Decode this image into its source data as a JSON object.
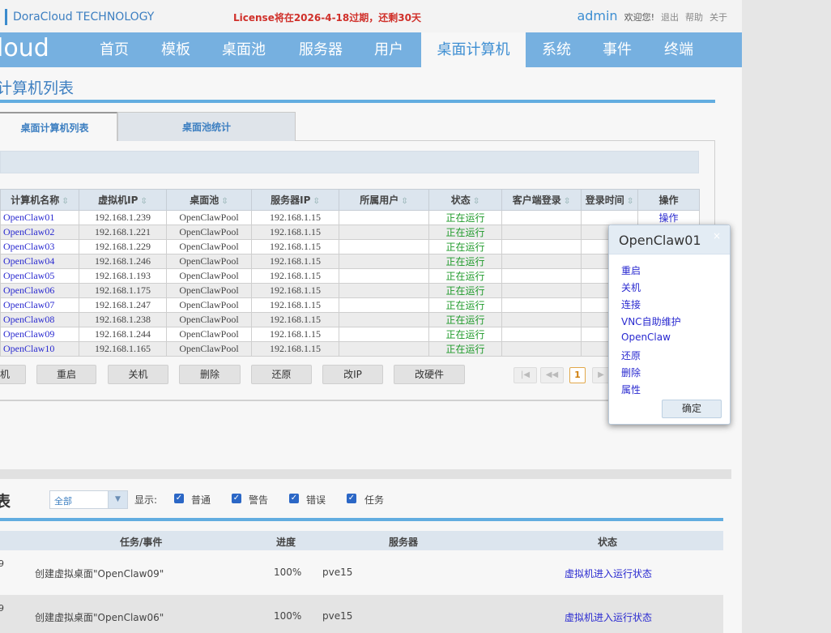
{
  "header": {
    "brand": "DoraCloud TECHNOLOGY",
    "license_notice": "License将在2026-4-18过期，还剩30天",
    "user": "admin",
    "welcome": "欢迎您!",
    "logout": "退出",
    "help": "帮助",
    "about": "关于"
  },
  "nav": {
    "logo": "loud",
    "items": [
      "首页",
      "模板",
      "桌面池",
      "服务器",
      "用户",
      "桌面计算机",
      "系统",
      "事件",
      "终端"
    ],
    "active_index": 5
  },
  "page": {
    "title": "计算机列表",
    "tabs": [
      "桌面计算机列表",
      "桌面池统计"
    ]
  },
  "vm_table": {
    "columns": [
      "计算机名称",
      "虚拟机IP",
      "桌面池",
      "服务器IP",
      "所属用户",
      "状态",
      "客户端登录",
      "登录时间",
      "操作"
    ],
    "sort_glyph": "⇳",
    "op_text": "操作",
    "rows": [
      {
        "name": "OpenClaw01",
        "ip": "192.168.1.239",
        "pool": "OpenClawPool",
        "server": "192.168.1.15",
        "user": "",
        "status": "正在运行",
        "client": "",
        "login_time": "",
        "op": "操作"
      },
      {
        "name": "OpenClaw02",
        "ip": "192.168.1.221",
        "pool": "OpenClawPool",
        "server": "192.168.1.15",
        "user": "",
        "status": "正在运行",
        "client": "",
        "login_time": "",
        "op": ""
      },
      {
        "name": "OpenClaw03",
        "ip": "192.168.1.229",
        "pool": "OpenClawPool",
        "server": "192.168.1.15",
        "user": "",
        "status": "正在运行",
        "client": "",
        "login_time": "",
        "op": ""
      },
      {
        "name": "OpenClaw04",
        "ip": "192.168.1.246",
        "pool": "OpenClawPool",
        "server": "192.168.1.15",
        "user": "",
        "status": "正在运行",
        "client": "",
        "login_time": "",
        "op": ""
      },
      {
        "name": "OpenClaw05",
        "ip": "192.168.1.193",
        "pool": "OpenClawPool",
        "server": "192.168.1.15",
        "user": "",
        "status": "正在运行",
        "client": "",
        "login_time": "",
        "op": ""
      },
      {
        "name": "OpenClaw06",
        "ip": "192.168.1.175",
        "pool": "OpenClawPool",
        "server": "192.168.1.15",
        "user": "",
        "status": "正在运行",
        "client": "",
        "login_time": "",
        "op": ""
      },
      {
        "name": "OpenClaw07",
        "ip": "192.168.1.247",
        "pool": "OpenClawPool",
        "server": "192.168.1.15",
        "user": "",
        "status": "正在运行",
        "client": "",
        "login_time": "",
        "op": ""
      },
      {
        "name": "OpenClaw08",
        "ip": "192.168.1.238",
        "pool": "OpenClawPool",
        "server": "192.168.1.15",
        "user": "",
        "status": "正在运行",
        "client": "",
        "login_time": "",
        "op": ""
      },
      {
        "name": "OpenClaw09",
        "ip": "192.168.1.244",
        "pool": "OpenClawPool",
        "server": "192.168.1.15",
        "user": "",
        "status": "正在运行",
        "client": "",
        "login_time": "",
        "op": ""
      },
      {
        "name": "OpenClaw10",
        "ip": "192.168.1.165",
        "pool": "OpenClawPool",
        "server": "192.168.1.15",
        "user": "",
        "status": "正在运行",
        "client": "",
        "login_time": "",
        "op": ""
      }
    ]
  },
  "actions": {
    "first_partial": "机",
    "buttons": [
      "重启",
      "关机",
      "删除",
      "还原",
      "改IP",
      "改硬件"
    ]
  },
  "pager": {
    "first": "|◀",
    "prev": "◀◀",
    "current": "1",
    "next": "▶"
  },
  "events": {
    "title": "表",
    "filter_value": "全部",
    "filter_arrow": "▼",
    "show_label": "显示:",
    "checkboxes": [
      "普通",
      "警告",
      "错误",
      "任务"
    ],
    "check_glyph": "✓",
    "columns": [
      "任务/事件",
      "进度",
      "服务器",
      "状态"
    ],
    "rows": [
      {
        "lead": "9",
        "task": "创建虚拟桌面\"OpenClaw09\"",
        "progress": "100%",
        "server": "pve15",
        "status": "虚拟机进入运行状态"
      },
      {
        "lead": "9",
        "task": "创建虚拟桌面\"OpenClaw06\"",
        "progress": "100%",
        "server": "pve15",
        "status": "虚拟机进入运行状态"
      }
    ]
  },
  "popup": {
    "title": "OpenClaw01",
    "close": "×",
    "items": [
      "重启",
      "关机",
      "连接",
      "VNC自助维护",
      "OpenClaw",
      "还原",
      "删除",
      "属性"
    ],
    "ok": "确定"
  },
  "colors": {
    "nav_bg": "#76b0e0",
    "accent": "#3d7fc1",
    "link": "#2a2ad0",
    "running": "#1f9a2a",
    "license": "#d0302a"
  }
}
